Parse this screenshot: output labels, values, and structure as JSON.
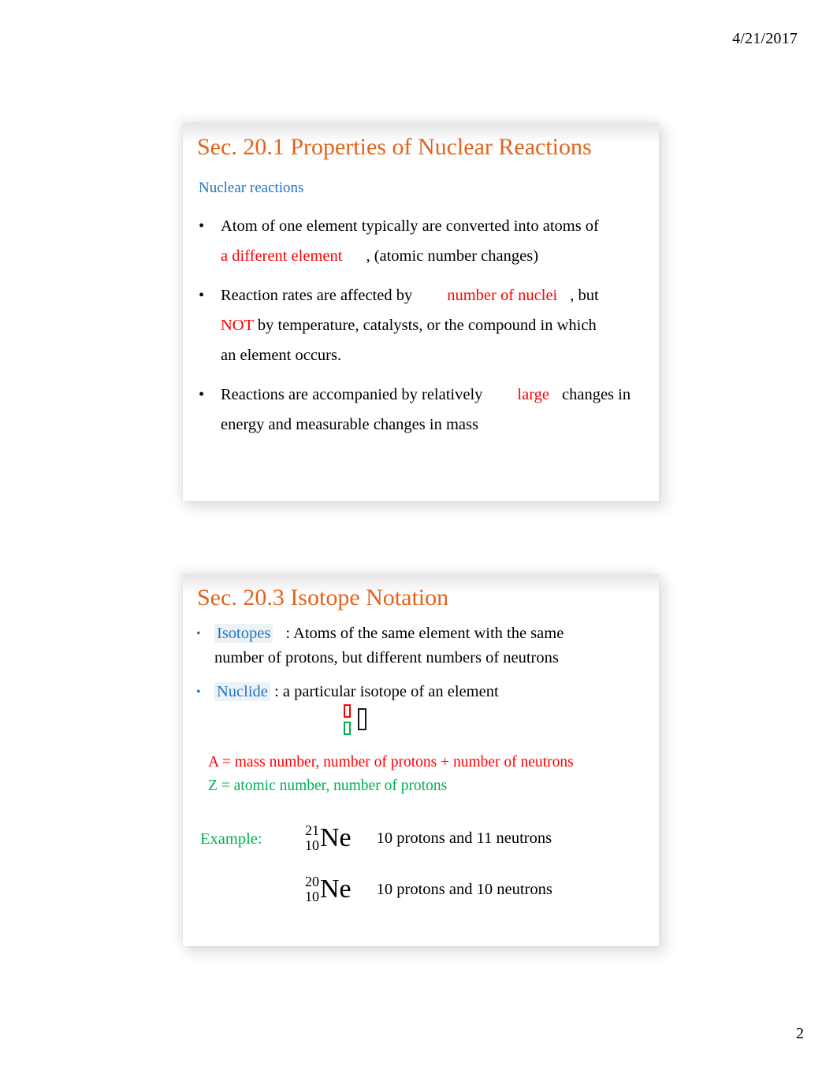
{
  "page": {
    "date": "4/21/2017",
    "number": "2"
  },
  "slides": [
    {
      "title": "Sec. 20.1 Properties of Nuclear Reactions",
      "subhead": "Nuclear reactions",
      "bullets": [
        {
          "marker": "•",
          "part1": "Atom of one element typically are converted into atoms of",
          "highlight": "a different element",
          "part2": ", (atomic number changes)"
        },
        {
          "marker": "•",
          "part1": "Reaction rates are affected by",
          "highlight": "number of nuclei",
          "part2": ", but",
          "highlight2": "NOT",
          "part3": "by temperature, catalysts, or the compound in which",
          "part4": "an element occurs."
        },
        {
          "marker": "•",
          "part1": "Reactions are accompanied by relatively",
          "highlight": "large",
          "part2": "changes in",
          "part3": "energy and measurable changes in mass"
        }
      ]
    },
    {
      "title": "Sec. 20.3 Isotope Notation",
      "definitions": [
        {
          "marker": "•",
          "term": "Isotopes",
          "colon": ": Atoms of the same element with the same",
          "line2": "number of protons, but different numbers of neutrons"
        },
        {
          "marker": "•",
          "term": "Nuclide",
          "colon": ":  a particular isotope of an element"
        }
      ],
      "nuclide_symbol": {
        "mass_number_glyph": "missing-glyph-box",
        "atomic_number_glyph": "missing-glyph-box",
        "element_glyph": "missing-glyph-box"
      },
      "legend": {
        "a_line": "A = mass number, number of protons + number of neutrons",
        "z_line": "Z = atomic number, number of protons"
      },
      "example_label": "Example:",
      "examples": [
        {
          "mass_number": "21",
          "atomic_number": "10",
          "symbol": "Ne",
          "description": "10 protons and 11 neutrons"
        },
        {
          "mass_number": "20",
          "atomic_number": "10",
          "symbol": "Ne",
          "description": "10 protons and 10 neutrons"
        }
      ]
    }
  ],
  "colors": {
    "title_orange": "#E3631B",
    "accent_blue": "#1F76C4",
    "highlight_red": "#FF0000",
    "highlight_green": "#00B050",
    "body_black": "#000000"
  }
}
